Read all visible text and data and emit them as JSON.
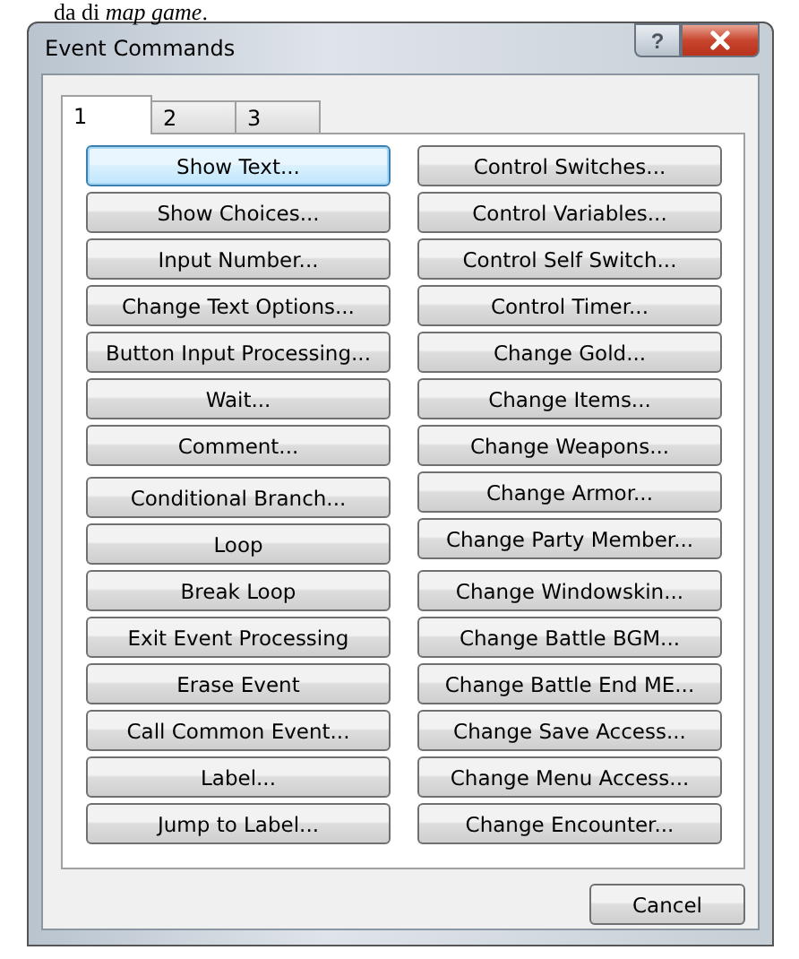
{
  "document_text": "da di *map game*.",
  "window": {
    "title": "Event Commands",
    "title_buttons": [
      {
        "kind": "help",
        "label": "?"
      },
      {
        "kind": "close"
      }
    ]
  },
  "tabs": [
    {
      "label": "1",
      "selected": true
    },
    {
      "label": "2",
      "selected": false
    },
    {
      "label": "3",
      "selected": false
    }
  ],
  "columns": [
    [
      [
        {
          "label": "Show Text...",
          "focused": true
        },
        {
          "label": "Show Choices...",
          "focused": false
        },
        {
          "label": "Input Number...",
          "focused": false
        },
        {
          "label": "Change Text Options...",
          "focused": false
        },
        {
          "label": "Button Input Processing...",
          "focused": false
        },
        {
          "label": "Wait...",
          "focused": false
        },
        {
          "label": "Comment...",
          "focused": false
        }
      ],
      [
        {
          "label": "Conditional Branch...",
          "focused": false
        },
        {
          "label": "Loop",
          "focused": false
        },
        {
          "label": "Break Loop",
          "focused": false
        },
        {
          "label": "Exit Event Processing",
          "focused": false
        },
        {
          "label": "Erase Event",
          "focused": false
        },
        {
          "label": "Call Common Event...",
          "focused": false
        },
        {
          "label": "Label...",
          "focused": false
        },
        {
          "label": "Jump to Label...",
          "focused": false
        }
      ]
    ],
    [
      [
        {
          "label": "Control Switches...",
          "focused": false
        },
        {
          "label": "Control Variables...",
          "focused": false
        },
        {
          "label": "Control Self Switch...",
          "focused": false
        },
        {
          "label": "Control Timer...",
          "focused": false
        },
        {
          "label": "Change Gold...",
          "focused": false
        },
        {
          "label": "Change Items...",
          "focused": false
        },
        {
          "label": "Change Weapons...",
          "focused": false
        },
        {
          "label": "Change Armor...",
          "focused": false
        },
        {
          "label": "Change Party Member...",
          "focused": false
        }
      ],
      [
        {
          "label": "Change Windowskin...",
          "focused": false
        },
        {
          "label": "Change Battle BGM...",
          "focused": false
        },
        {
          "label": "Change Battle End ME...",
          "focused": false
        },
        {
          "label": "Change Save Access...",
          "focused": false
        },
        {
          "label": "Change Menu Access...",
          "focused": false
        },
        {
          "label": "Change Encounter...",
          "focused": false
        }
      ]
    ]
  ],
  "buttons": [
    "Cancel"
  ]
}
